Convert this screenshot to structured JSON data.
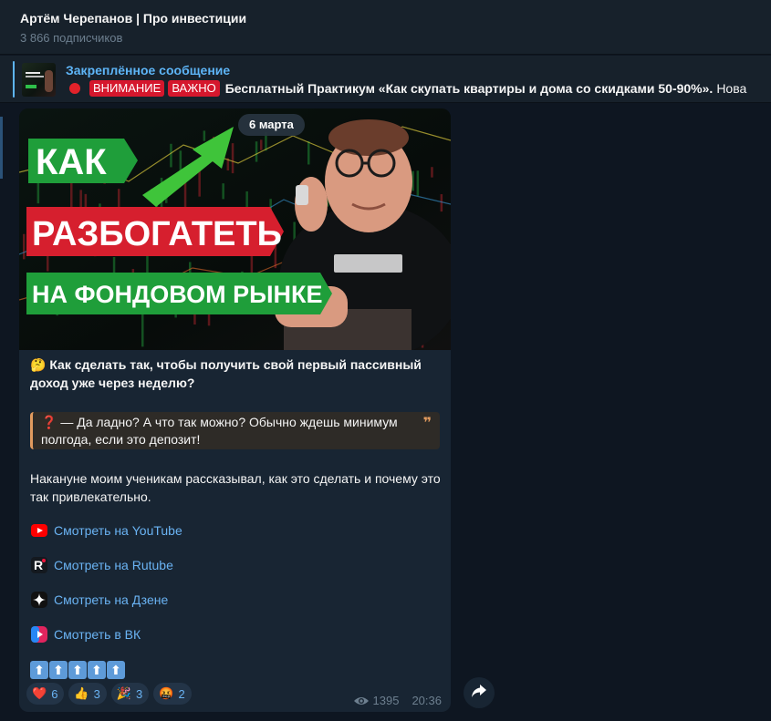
{
  "channel": {
    "title": "Артём Черепанов | Про инвестиции",
    "subscribers": "3 866 подписчиков"
  },
  "pinned": {
    "title": "Закреплённое сообщение",
    "badge1": "ВНИМАНИЕ",
    "badge2": "ВАЖНО",
    "text": "Бесплатный Практикум «Как скупать квартиры и дома со скидками 50-90%».",
    "more": "Нова"
  },
  "post": {
    "date_pill": "6 марта",
    "thumbnail": {
      "line1": "КАК",
      "line2": "РАЗБОГАТЕТЬ",
      "line3": "НА ФОНДОВОМ РЫНКЕ"
    },
    "caption_emoji": "🤔",
    "caption": "Как сделать так, чтобы получить свой первый пассивный доход уже через неделю?",
    "quote_icon": "❓",
    "quote": "— Да ладно? А что так можно? Обычно ждешь минимум полгода, если это депозит!",
    "quote_mark": "❞",
    "paragraph": "Накануне моим ученикам рассказывал, как это сделать и почему это так привлекательно.",
    "links": [
      {
        "label": "Смотреть на YouTube",
        "icon": "youtube-icon"
      },
      {
        "label": "Смотреть на Rutube",
        "icon": "rutube-icon"
      },
      {
        "label": "Смотреть на Дзене",
        "icon": "dzen-icon"
      },
      {
        "label": "Смотреть в ВК",
        "icon": "vk-video-icon"
      }
    ],
    "arrows": [
      "⬆",
      "⬆",
      "⬆",
      "⬆",
      "⬆"
    ],
    "reactions": [
      {
        "emoji": "❤️",
        "count": "6"
      },
      {
        "emoji": "👍",
        "count": "3"
      },
      {
        "emoji": "🎉",
        "count": "3"
      },
      {
        "emoji": "🤬",
        "count": "2"
      }
    ],
    "views": "1395",
    "time": "20:36"
  },
  "colors": {
    "accent": "#5eb5f7",
    "link": "#6ab3f3",
    "bubble": "#182533",
    "background": "#0e1621",
    "header": "#17212b",
    "badge": "#d5172d",
    "quote_border": "#e19a5e"
  }
}
